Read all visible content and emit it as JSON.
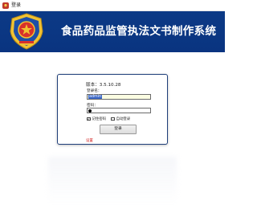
{
  "window": {
    "title": "登录",
    "icon": "emblem-icon"
  },
  "banner": {
    "system_title": "食品药品监管执法文书制作系统",
    "background": "#0c3a86",
    "emblem": "badge-emblem-icon"
  },
  "login": {
    "version_text": "版本：3.5.10.28",
    "username_label": "登录名：",
    "username_value": "admin",
    "password_label": "密码：",
    "remember_password_label": "记住密码",
    "remember_password_checked": true,
    "auto_login_label": "自动登录",
    "auto_login_checked": false,
    "login_button": "登录",
    "settings_link": "设置",
    "settings_color": "#d11a1a"
  }
}
